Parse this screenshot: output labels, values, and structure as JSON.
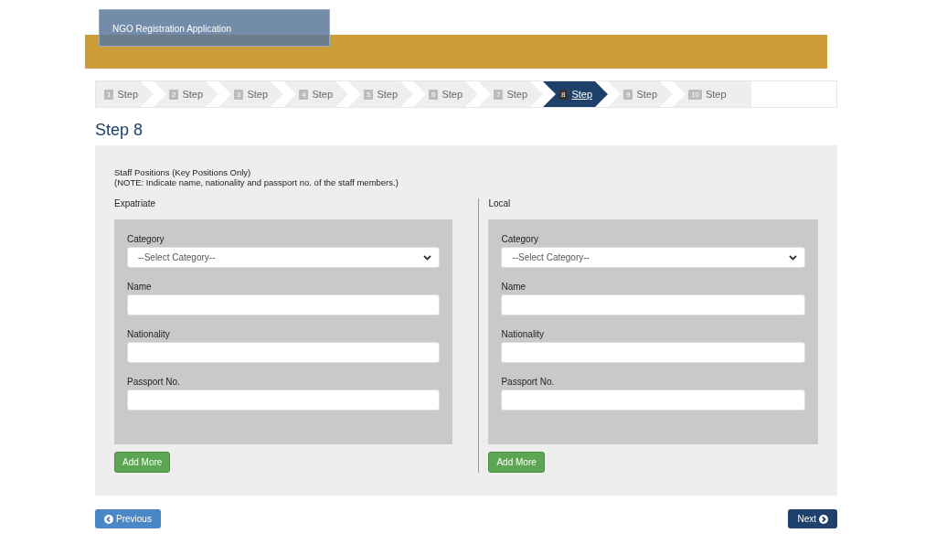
{
  "header": {
    "title": "NGO Registration Application"
  },
  "steps": [
    {
      "number": "1",
      "label": "Step",
      "selected": false
    },
    {
      "number": "2",
      "label": "Step",
      "selected": false
    },
    {
      "number": "3",
      "label": "Step",
      "selected": false
    },
    {
      "number": "4",
      "label": "Step",
      "selected": false
    },
    {
      "number": "5",
      "label": "Step",
      "selected": false
    },
    {
      "number": "6",
      "label": "Step",
      "selected": false
    },
    {
      "number": "7",
      "label": "Step",
      "selected": false
    },
    {
      "number": "8",
      "label": "Step",
      "selected": true
    },
    {
      "number": "9",
      "label": "Step",
      "selected": false
    },
    {
      "number": "10",
      "label": "Step",
      "selected": false
    }
  ],
  "page_title": "Step 8",
  "intro": [
    "Staff Positions (Key Positions Only)",
    "(NOTE: Indicate name, nationality and passport no. of the staff members.)"
  ],
  "columns": [
    {
      "heading": "Expatriate",
      "fields": [
        {
          "kind": "select",
          "label": "Category",
          "value": "--Select Category--"
        },
        {
          "kind": "text",
          "label": "Name"
        },
        {
          "kind": "text",
          "label": "Nationality"
        },
        {
          "kind": "text",
          "label": "Passport No."
        }
      ],
      "button": "Add More"
    },
    {
      "heading": "Local",
      "fields": [
        {
          "kind": "select",
          "label": "Category",
          "value": "--Select Category--"
        },
        {
          "kind": "text",
          "label": "Name"
        },
        {
          "kind": "text",
          "label": "Nationality"
        },
        {
          "kind": "text",
          "label": "Passport No."
        }
      ],
      "button": "Add More"
    }
  ],
  "nav": {
    "previous": "Previous",
    "next": "Next"
  }
}
